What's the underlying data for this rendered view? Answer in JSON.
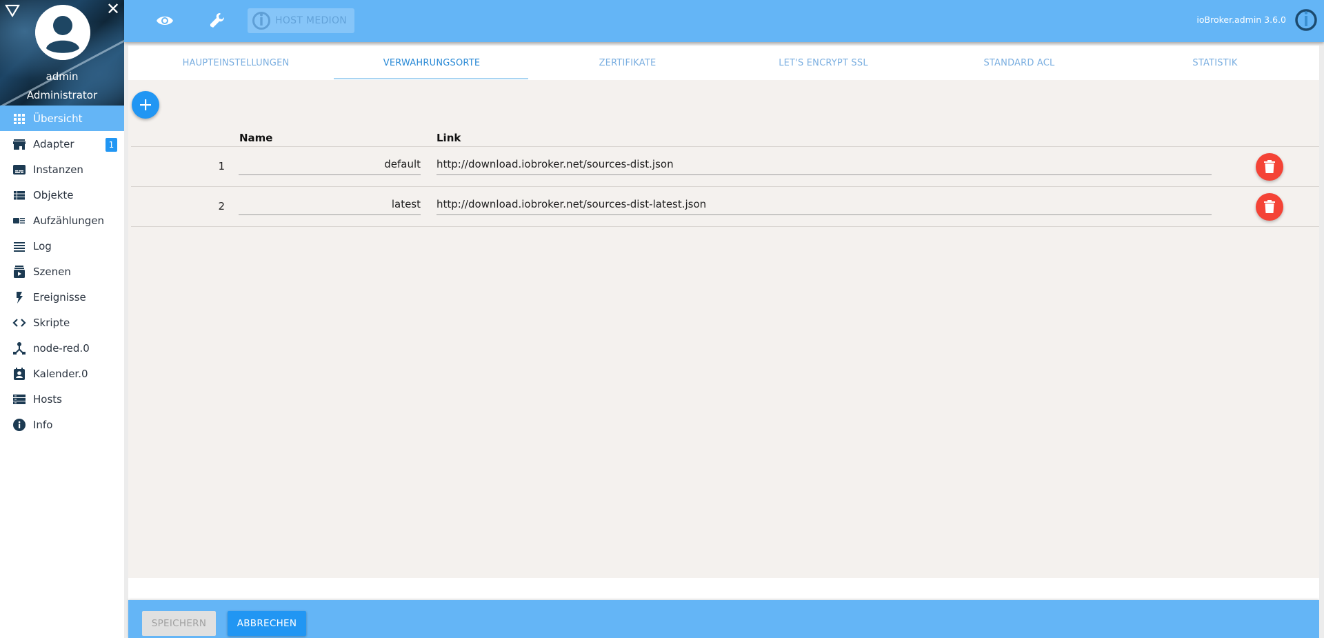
{
  "sidebar": {
    "user_name": "admin",
    "user_role": "Administrator",
    "items": [
      {
        "label": "Übersicht",
        "icon": "apps-icon",
        "active": true
      },
      {
        "label": "Adapter",
        "icon": "store-icon",
        "badge": "1"
      },
      {
        "label": "Instanzen",
        "icon": "subtitles-icon"
      },
      {
        "label": "Objekte",
        "icon": "view-list-icon"
      },
      {
        "label": "Aufzählungen",
        "icon": "enum-list-icon"
      },
      {
        "label": "Log",
        "icon": "log-lines-icon"
      },
      {
        "label": "Szenen",
        "icon": "scenes-icon"
      },
      {
        "label": "Ereignisse",
        "icon": "flash-icon"
      },
      {
        "label": "Skripte",
        "icon": "code-icon"
      },
      {
        "label": "node-red.0",
        "icon": "node-graph-icon"
      },
      {
        "label": "Kalender.0",
        "icon": "calendar-contact-icon"
      },
      {
        "label": "Hosts",
        "icon": "server-icon"
      },
      {
        "label": "Info",
        "icon": "info-icon"
      }
    ]
  },
  "appbar": {
    "host_label": "HOST MEDION",
    "version": "ioBroker.admin 3.6.0"
  },
  "tabs": [
    {
      "label": "HAUPTEINSTELLUNGEN",
      "active": false
    },
    {
      "label": "VERWAHRUNGSORTE",
      "active": true
    },
    {
      "label": "ZERTIFIKATE",
      "active": false
    },
    {
      "label": "LET'S ENCRYPT SSL",
      "active": false
    },
    {
      "label": "STANDARD ACL",
      "active": false
    },
    {
      "label": "STATISTIK",
      "active": false
    }
  ],
  "table": {
    "headers": {
      "name": "Name",
      "link": "Link"
    },
    "rows": [
      {
        "index": "1",
        "name": "default",
        "link": "http://download.iobroker.net/sources-dist.json"
      },
      {
        "index": "2",
        "name": "latest",
        "link": "http://download.iobroker.net/sources-dist-latest.json"
      }
    ]
  },
  "footer": {
    "save_label": "SPEICHERN",
    "cancel_label": "ABBRECHEN"
  },
  "colors": {
    "primary": "#64b5f6",
    "accent": "#2196f3",
    "danger": "#f44336",
    "content_bg": "#f4f1ee"
  }
}
